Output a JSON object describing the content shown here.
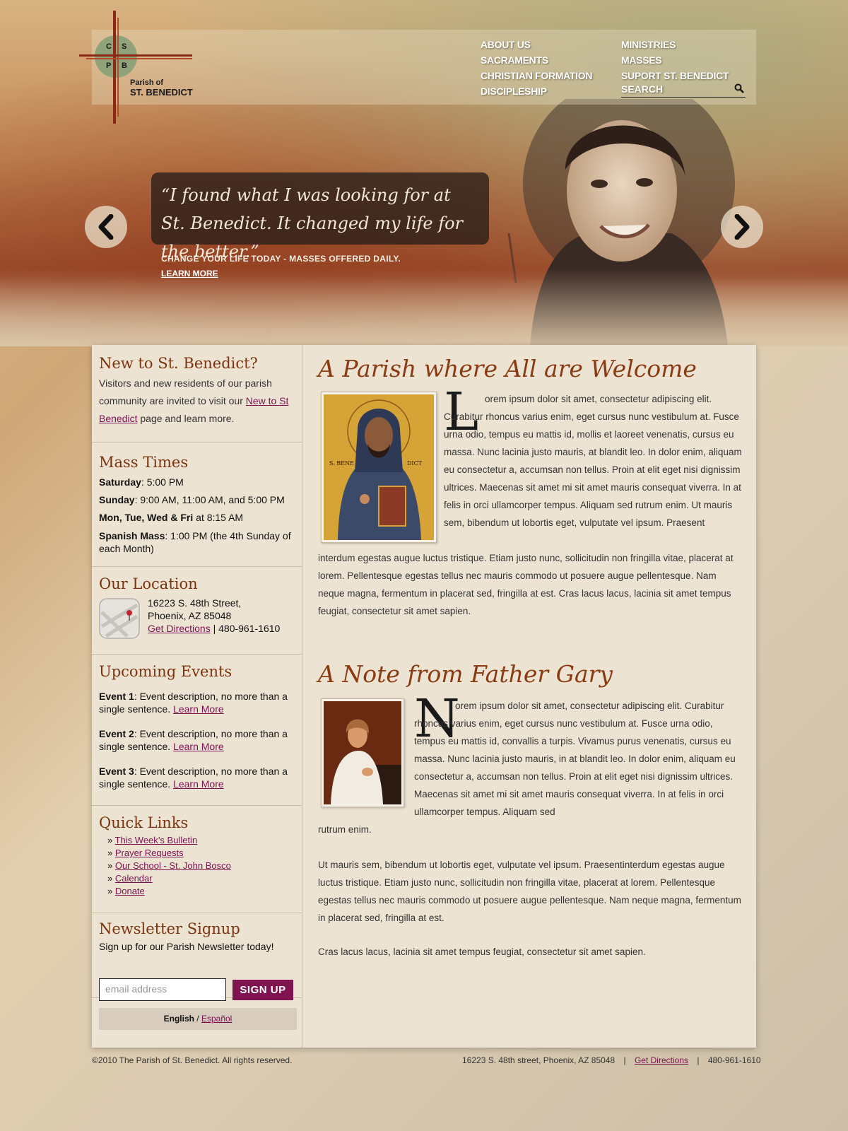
{
  "logo": {
    "letters": [
      "C",
      "S",
      "P",
      "B"
    ],
    "line1": "Parish of",
    "line2": "ST. BENEDICT"
  },
  "nav": {
    "col1": [
      "ABOUT US",
      "SACRAMENTS",
      "CHRISTIAN FORMATION",
      "DISCIPLESHIP"
    ],
    "col2": [
      "MINISTRIES",
      "MASSES",
      "SUPORT ST. BENEDICT"
    ],
    "search_label": "SEARCH"
  },
  "hero": {
    "quote": "“I found what I was looking for at St. Benedict. It changed my life for the better.”",
    "sub": "CHANGE YOUR LIFE TODAY - MASSES OFFERED DAILY.",
    "link": "LEARN MORE"
  },
  "sidebar": {
    "new": {
      "title": "New to St. Benedict?",
      "text1": "Visitors and new residents of our parish community are invited to visit our ",
      "link": "New to St Benedict",
      "text2": " page and learn more."
    },
    "mass": {
      "title": "Mass Times",
      "lines": [
        {
          "day": "Saturday",
          "time": ": 5:00 PM"
        },
        {
          "day": "Sunday",
          "time": ": 9:00 AM, 11:00 AM, and 5:00 PM"
        },
        {
          "day": "Mon, Tue, Wed & Fri",
          "time": " at 8:15 AM"
        },
        {
          "day": "Spanish Mass",
          "time": ": 1:00 PM (the 4th Sunday of each Month)"
        }
      ]
    },
    "location": {
      "title": "Our Location",
      "line1": "16223 S. 48th Street,",
      "line2": "Phoenix, AZ 85048",
      "directions": "Get Directions",
      "phone": " | 480-961-1610"
    },
    "events": {
      "title": "Upcoming Events",
      "items": [
        {
          "name": "Event 1",
          "desc": ": Event description, no more than a single sentence. ",
          "link": "Learn More"
        },
        {
          "name": "Event 2",
          "desc": ": Event description, no more than a single sentence. ",
          "link": "Learn More"
        },
        {
          "name": "Event 3",
          "desc": ": Event description, no more than a single sentence. ",
          "link": "Learn More"
        }
      ]
    },
    "quicklinks": {
      "title": "Quick Links",
      "items": [
        "This Week’s Bulletin",
        "Prayer Requests",
        "Our School - St. John Bosco",
        "Calendar",
        "Donate"
      ]
    },
    "newsletter": {
      "title": "Newsletter Signup",
      "text": "Sign up for our Parish Newsletter today!",
      "placeholder": "email address",
      "button": "SIGN UP"
    },
    "lang": {
      "current": "English",
      "sep": " / ",
      "other": "Español"
    }
  },
  "main": {
    "welcome": {
      "title": "A Parish where All are Welcome",
      "dropcap": "L",
      "text1": "orem ipsum dolor sit amet, consectetur adipiscing elit. Curabitur rhoncus varius enim, eget cursus nunc vestibulum at. Fusce urna odio, tempus eu mattis id, mollis et laoreet venenatis, cursus eu massa. Nunc lacinia justo mauris, at blandit leo. In dolor enim, aliquam eu consectetur a, accumsan non tellus. Proin at elit eget nisi dignissim ultrices. Maecenas sit amet mi sit amet mauris consequat viverra. In at felis in orci ullamcorper tempus. Aliquam sed rutrum enim. Ut mauris sem, bibendum ut lobortis eget, vulputate vel ipsum. Praesent",
      "text2": "interdum egestas augue luctus tristique. Etiam justo nunc, sollicitudin non fringilla vitae, placerat at lorem. Pellentesque egestas tellus nec mauris commodo ut posuere augue pellentesque. Nam neque magna, fermentum in placerat sed, fringilla at est. Cras lacus lacus, lacinia sit amet tempus feugiat, consectetur sit amet sapien.",
      "icon_left": "S. BENE",
      "icon_right": "DICT"
    },
    "note": {
      "title": "A Note from Father Gary",
      "dropcap": "N",
      "text1": "orem ipsum dolor sit amet, consectetur adipiscing elit. Curabitur rhoncus varius enim, eget cursus nunc vestibulum at. Fusce urna odio, tempus eu mattis id, convallis a turpis. Vivamus purus venenatis, cursus eu massa. Nunc lacinia justo mauris, in at blandit leo. In dolor enim, aliquam eu consectetur a, accumsan non tellus. Proin at elit eget nisi dignissim ultrices. Maecenas sit amet mi sit amet mauris consequat viverra. In at felis in orci ullamcorper tempus. Aliquam sed",
      "text2": "rutrum enim.",
      "text3": "Ut mauris sem, bibendum ut lobortis eget, vulputate vel ipsum. Praesentinterdum egestas augue luctus tristique. Etiam justo nunc, sollicitudin non fringilla vitae, placerat at lorem. Pellentesque egestas tellus nec mauris commodo ut posuere augue pellentesque. Nam neque magna, fermentum in placerat sed, fringilla at est.",
      "text4": "Cras lacus lacus, lacinia sit amet tempus feugiat, consectetur sit amet sapien."
    }
  },
  "footer": {
    "copyright": "©2010 The Parish of St. Benedict.  All rights reserved.",
    "address": "16223 S. 48th street, Phoenix, AZ 85048",
    "sep": "|",
    "directions": "Get Directions",
    "phone": "480-961-1610"
  },
  "colors": {
    "accent": "#7f1450",
    "heading": "#7c3410",
    "content_bg": "#ece3d3"
  }
}
